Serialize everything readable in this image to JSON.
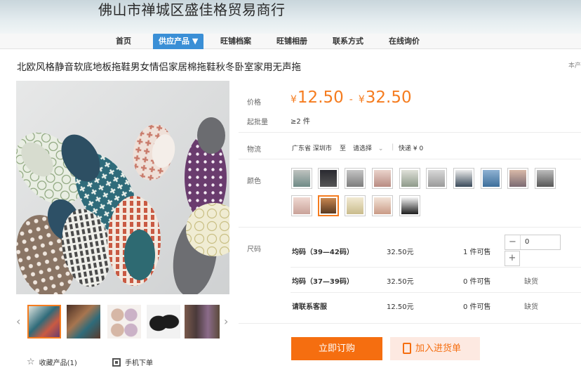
{
  "header": {
    "shop_name": "佛山市禅城区盛佳格贸易商行"
  },
  "nav": {
    "items": [
      {
        "label": "首页"
      },
      {
        "label": "供应产品 ▼"
      },
      {
        "label": "旺铺档案"
      },
      {
        "label": "旺铺相册"
      },
      {
        "label": "联系方式"
      },
      {
        "label": "在线询价"
      }
    ]
  },
  "product": {
    "title": "北欧风格静音软底地板拖鞋男女情侣家居棉拖鞋秋冬卧室家用无声拖",
    "corner_note": "本产"
  },
  "price": {
    "label": "价格",
    "yen": "¥",
    "low": "12.50",
    "sep": "-",
    "high": "32.50"
  },
  "moq": {
    "label": "起批量",
    "value": "≥2 件"
  },
  "logistics": {
    "label": "物流",
    "origin": "广东省 深圳市",
    "to_label": "至",
    "select_placeholder": "请选择",
    "shipping": "快递 ¥ 0"
  },
  "colors": {
    "label": "颜色",
    "selected_index": 11
  },
  "sizes": {
    "label": "尺码",
    "rows": [
      {
        "name": "均码（39—42码）",
        "price": "32.50元",
        "stock": "1 件可售",
        "qty": "0",
        "status": ""
      },
      {
        "name": "均码（37—39码）",
        "price": "32.50元",
        "stock": "0 件可售",
        "qty": "",
        "status": "缺货"
      },
      {
        "name": "请联系客服",
        "price": "12.50元",
        "stock": "0 件可售",
        "qty": "",
        "status": "缺货"
      }
    ]
  },
  "buttons": {
    "buy": "立即订购",
    "cart": "加入进货单"
  },
  "actions": {
    "favorite": "收藏产品(1)",
    "mobile": "手机下单"
  }
}
